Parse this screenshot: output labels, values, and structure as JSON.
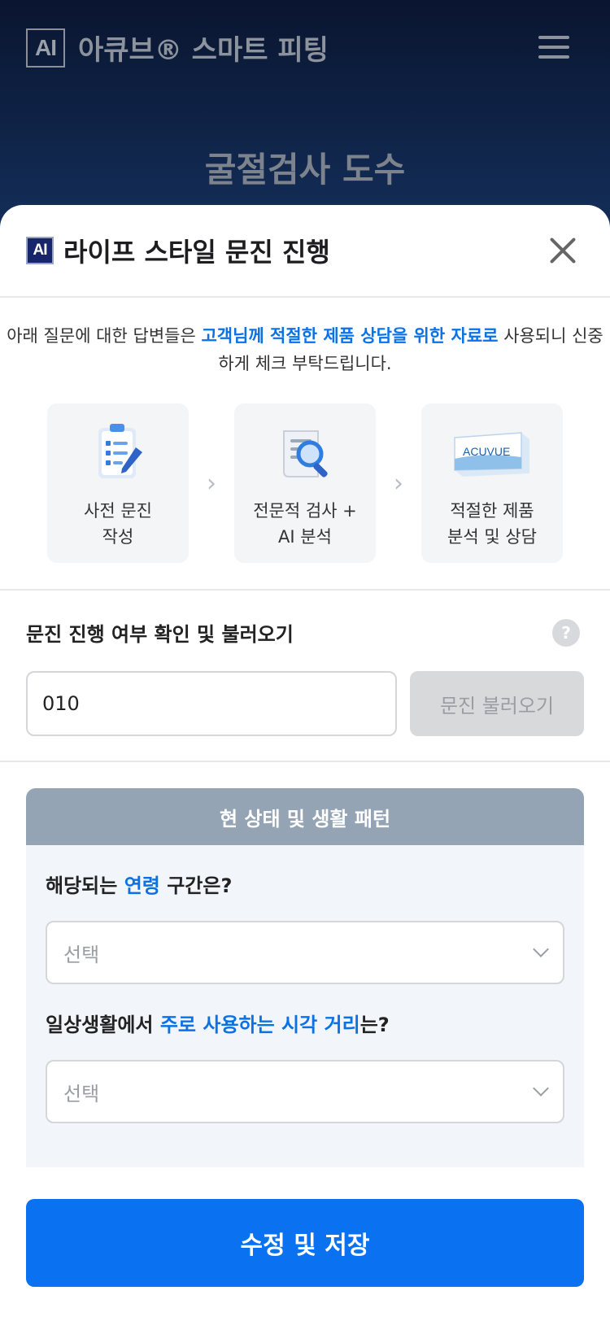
{
  "app": {
    "logo_text": "AI",
    "title": "아큐브® 스마트 피팅",
    "page_title": "굴절검사 도수"
  },
  "sheet": {
    "badge": "AI",
    "title": "라이프 스타일 문진 진행",
    "intro": {
      "part1": "아래 질문에 대한 답변들은 ",
      "highlight": "고객님께 적절한 제품 상담을 위한 자료로",
      "part2": " 사용되니 신중하게 체크 부탁드립니다."
    },
    "steps": [
      {
        "label_line1": "사전 문진",
        "label_line2": "작성",
        "icon": "clipboard-icon"
      },
      {
        "label_line1": "전문적 검사 +",
        "label_line2": "AI 분석",
        "icon": "document-magnifier-icon"
      },
      {
        "label_line1": "적절한 제품",
        "label_line2": "분석 및 상담",
        "icon": "acuvue-box-icon"
      }
    ],
    "step_arrow": "›",
    "product_box_text": "ACUVUE"
  },
  "load": {
    "title": "문진 진행 여부 확인 및 불러오기",
    "help": "?",
    "phone_value": "010",
    "button_label": "문진 불러오기"
  },
  "card": {
    "header": "현 상태 및 생활 패턴",
    "q1": {
      "pre": "해당되는 ",
      "hl": "연령",
      "post": " 구간은?",
      "select_value": "선택"
    },
    "q2": {
      "pre": "일상생활에서 ",
      "hl": "주로 사용하는 시각 거리",
      "post": "는?",
      "select_value": "선택"
    }
  },
  "save_label": "수정 및 저장",
  "colors": {
    "accent": "#0a72e6",
    "primary_button": "#0a72f0",
    "card_header": "#94a4b4"
  }
}
